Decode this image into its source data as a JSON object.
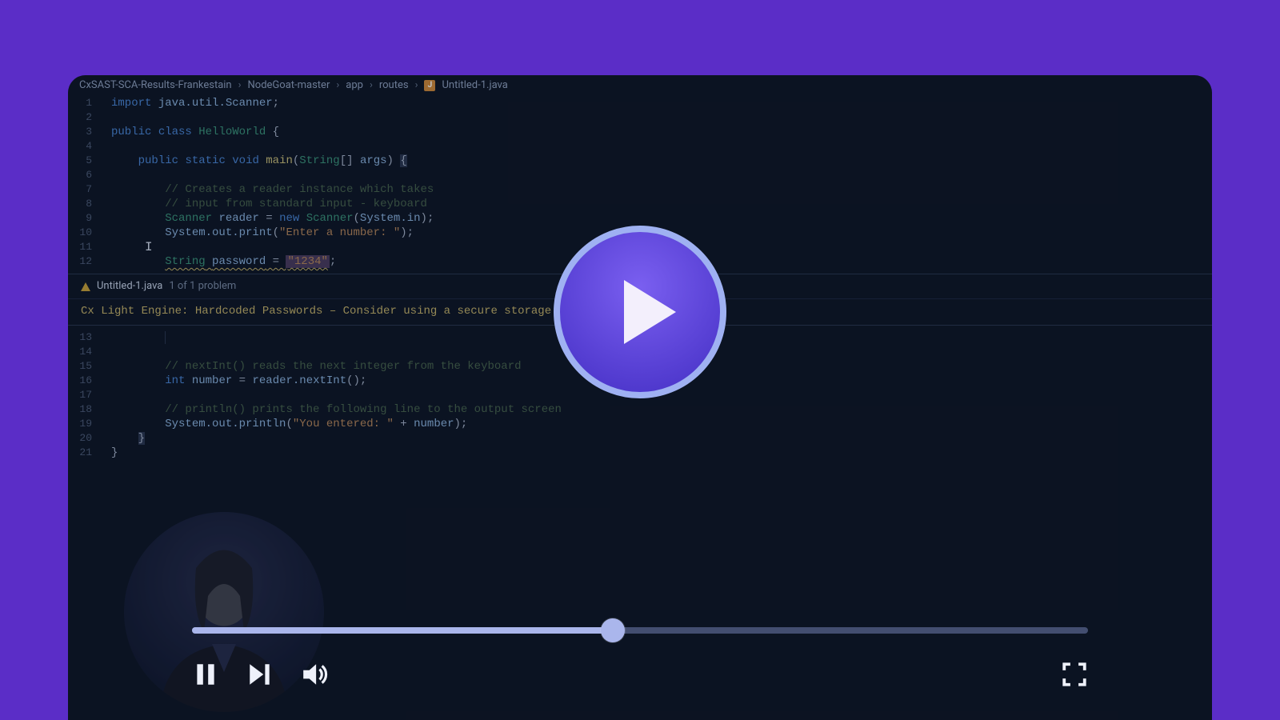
{
  "breadcrumb": {
    "parts": [
      "CxSAST-SCA-Results-Frankestain",
      "NodeGoat-master",
      "app",
      "routes",
      "Untitled-1.java"
    ],
    "file_icon_letter": "J"
  },
  "code": {
    "lines": [
      {
        "n": 1
      },
      {
        "n": 2
      },
      {
        "n": 3
      },
      {
        "n": 4
      },
      {
        "n": 5
      },
      {
        "n": 6
      },
      {
        "n": 7
      },
      {
        "n": 8
      },
      {
        "n": 9
      },
      {
        "n": 10
      },
      {
        "n": 11
      },
      {
        "n": 12
      }
    ],
    "tokens": {
      "import_kw": "import",
      "import_pkg": "java.util.Scanner",
      "public_kw": "public",
      "class_kw": "class",
      "class_name": "HelloWorld",
      "static_kw": "static",
      "void_kw": "void",
      "main_mth": "main",
      "string_type": "String",
      "args_ident": "args",
      "cmt7": "// Creates a reader instance which takes",
      "cmt8": "// input from standard input - keyboard",
      "scanner": "Scanner",
      "reader_ident": "reader",
      "new_kw": "new",
      "system_in": "System.in",
      "sysout": "System.out.print",
      "prompt_str": "\"Enter a number: \"",
      "string_kw": "String",
      "password_ident": "password",
      "password_val": "\"1234\""
    },
    "second_block": {
      "lines": [
        {
          "n": 13
        },
        {
          "n": 14
        },
        {
          "n": 15
        },
        {
          "n": 16
        },
        {
          "n": 17
        },
        {
          "n": 18
        },
        {
          "n": 19
        },
        {
          "n": 20
        },
        {
          "n": 21
        }
      ],
      "cmt15": "// nextInt() reads the next integer from the keyboard",
      "int_kw": "int",
      "number_ident": "number",
      "reader_call": "reader.nextInt",
      "cmt18": "// println() prints the following line to the output screen",
      "sysoutln": "System.out.println",
      "entered_str": "\"You entered: \"",
      "plus": " + ",
      "number_ref": "number"
    }
  },
  "problems": {
    "file": "Untitled-1.java",
    "count": "1 of 1 problem",
    "message": "Cx Light Engine: Hardcoded Passwords – Consider using a secure storage for passwords                          erty"
  },
  "player": {
    "progress_percent": 47
  }
}
